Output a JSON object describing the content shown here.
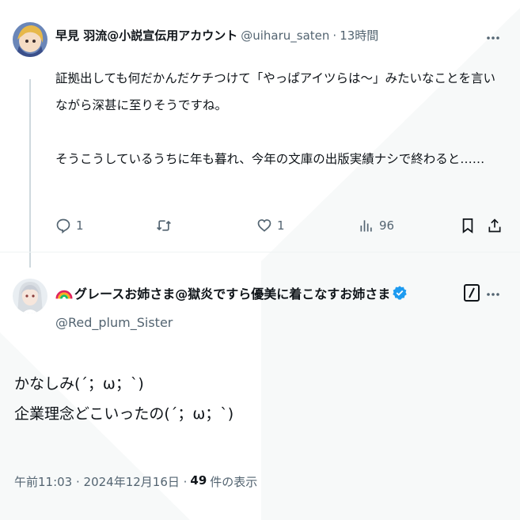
{
  "reply_tweet": {
    "author_name": "早見 羽流@小説宣伝用アカウント",
    "handle": "@uiharu_saten",
    "separator": "·",
    "time": "13時間",
    "text": "証拠出しても何だかんだケチつけて「やっぱアイツらは〜」みたいなことを言いながら深甚に至りそうですね。\n\nそうこうしているうちに年も暮れ、今年の文庫の出版実績ナシで終わると……",
    "actions": {
      "reply_count": "1",
      "retweet_count": "",
      "like_count": "1",
      "view_count": "96"
    },
    "icons": [
      "more-icon",
      "reply-icon",
      "retweet-icon",
      "like-icon",
      "views-icon",
      "bookmark-icon",
      "share-icon"
    ]
  },
  "main_tweet": {
    "author_name": "グレースお姉さま@獄炎ですら優美に着こなすお姉さま",
    "handle": "@Red_plum_Sister",
    "verified": true,
    "text": "かなしみ(´；ω；`)\n企業理念どこいったの(´；ω；`)",
    "timestamp": "午前11:03 · 2024年12月16日 ·",
    "view_count": "49",
    "view_suffix": "件の表示",
    "icons": [
      "rainbow-icon",
      "verified-badge-icon",
      "grok-icon",
      "more-icon"
    ]
  },
  "colors": {
    "text_primary": "#0f1419",
    "text_secondary": "#536471",
    "verified_blue": "#1d9bf0",
    "divider": "#eff3f4"
  }
}
